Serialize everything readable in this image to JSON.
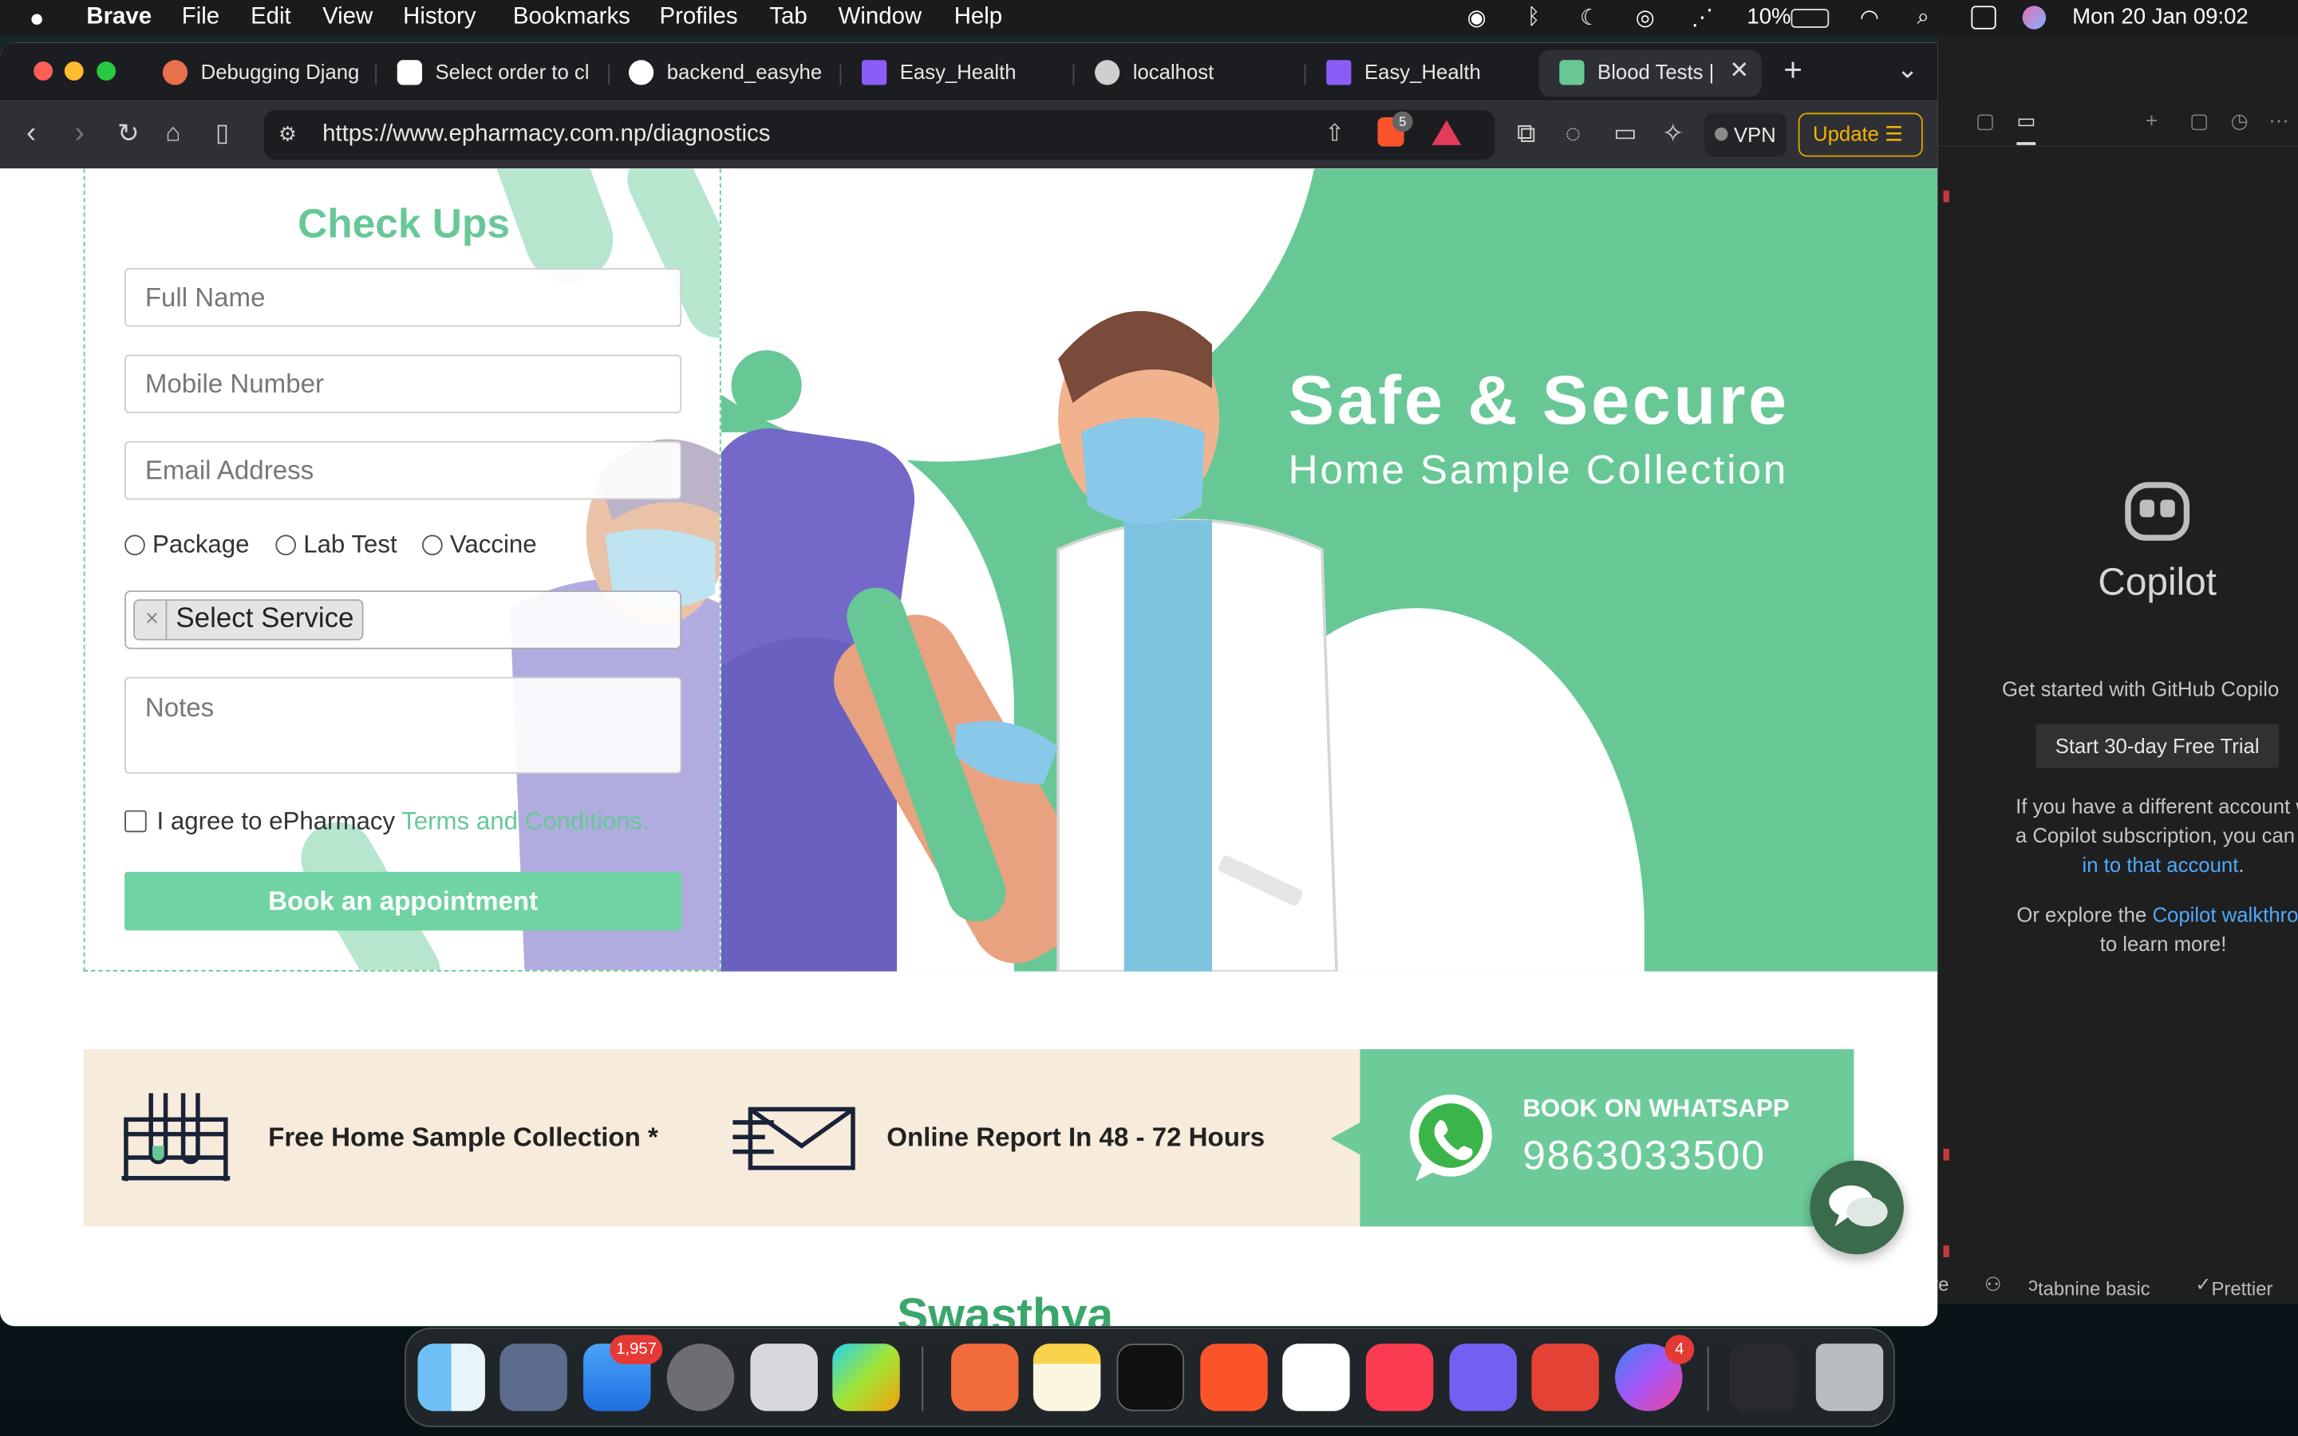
{
  "menubar": {
    "app": "Brave",
    "items": [
      "File",
      "Edit",
      "View",
      "History",
      "Bookmarks",
      "Profiles",
      "Tab",
      "Window",
      "Help"
    ],
    "battery": "10%",
    "datetime": "Mon 20 Jan  09:02"
  },
  "tabs": [
    {
      "title": "Debugging Djang",
      "icon_color": "#e8704a"
    },
    {
      "title": "Select order to cl",
      "icon_color": "#ffffff"
    },
    {
      "title": "backend_easyhe",
      "icon_color": "#ffffff"
    },
    {
      "title": "Easy_Health",
      "icon_color": "#8b5cf6"
    },
    {
      "title": "localhost",
      "icon_color": "#cfcfcf"
    },
    {
      "title": "Easy_Health",
      "icon_color": "#8b5cf6"
    },
    {
      "title": "Blood Tests |",
      "icon_color": "#67c896",
      "active": true
    }
  ],
  "toolbar": {
    "url": "https://www.epharmacy.com.np/diagnostics",
    "shields_count": "5",
    "vpn": "VPN",
    "update": "Update"
  },
  "form": {
    "title": "Check Ups",
    "full_name": "Full Name",
    "mobile": "Mobile Number",
    "email": "Email Address",
    "radios": [
      "Package",
      "Lab Test",
      "Vaccine"
    ],
    "select_service": "Select Service",
    "notes": "Notes",
    "agree_text": "I agree to ePharmacy ",
    "terms_link": "Terms and Conditions.",
    "book_button": "Book an appointment"
  },
  "hero": {
    "title": "Safe & Secure",
    "subtitle": "Home Sample Collection"
  },
  "infobar": {
    "item1": "Free Home Sample Collection *",
    "item2": "Online Report In 48 - 72 Hours",
    "whatsapp_label": "BOOK ON WHATSAPP",
    "whatsapp_number": "9863033500"
  },
  "next_section_heading": "Swasthya",
  "copilot": {
    "title": "Copilot",
    "get_started": "Get started with GitHub Copilo",
    "trial_button": "Start 30-day Free Trial",
    "para1_line1": "If you have a different account w",
    "para1_line2": "a Copilot subscription, you can s",
    "para1_link": "in to that account",
    "para2_prefix": "Or explore the ",
    "para2_link": "Copilot walkthrou",
    "para2_suffix": "to learn more!",
    "status_tabnine": "tabnine basic",
    "status_prettier": "Prettier",
    "status_left": "ve"
  },
  "dock": {
    "mail_badge": "1,957",
    "messenger_badge": "4"
  },
  "colors": {
    "brand_green": "#67c896",
    "button_green": "#6fd3a4",
    "infobar_bg": "#f7ebdb",
    "update_accent": "#e0a400"
  }
}
